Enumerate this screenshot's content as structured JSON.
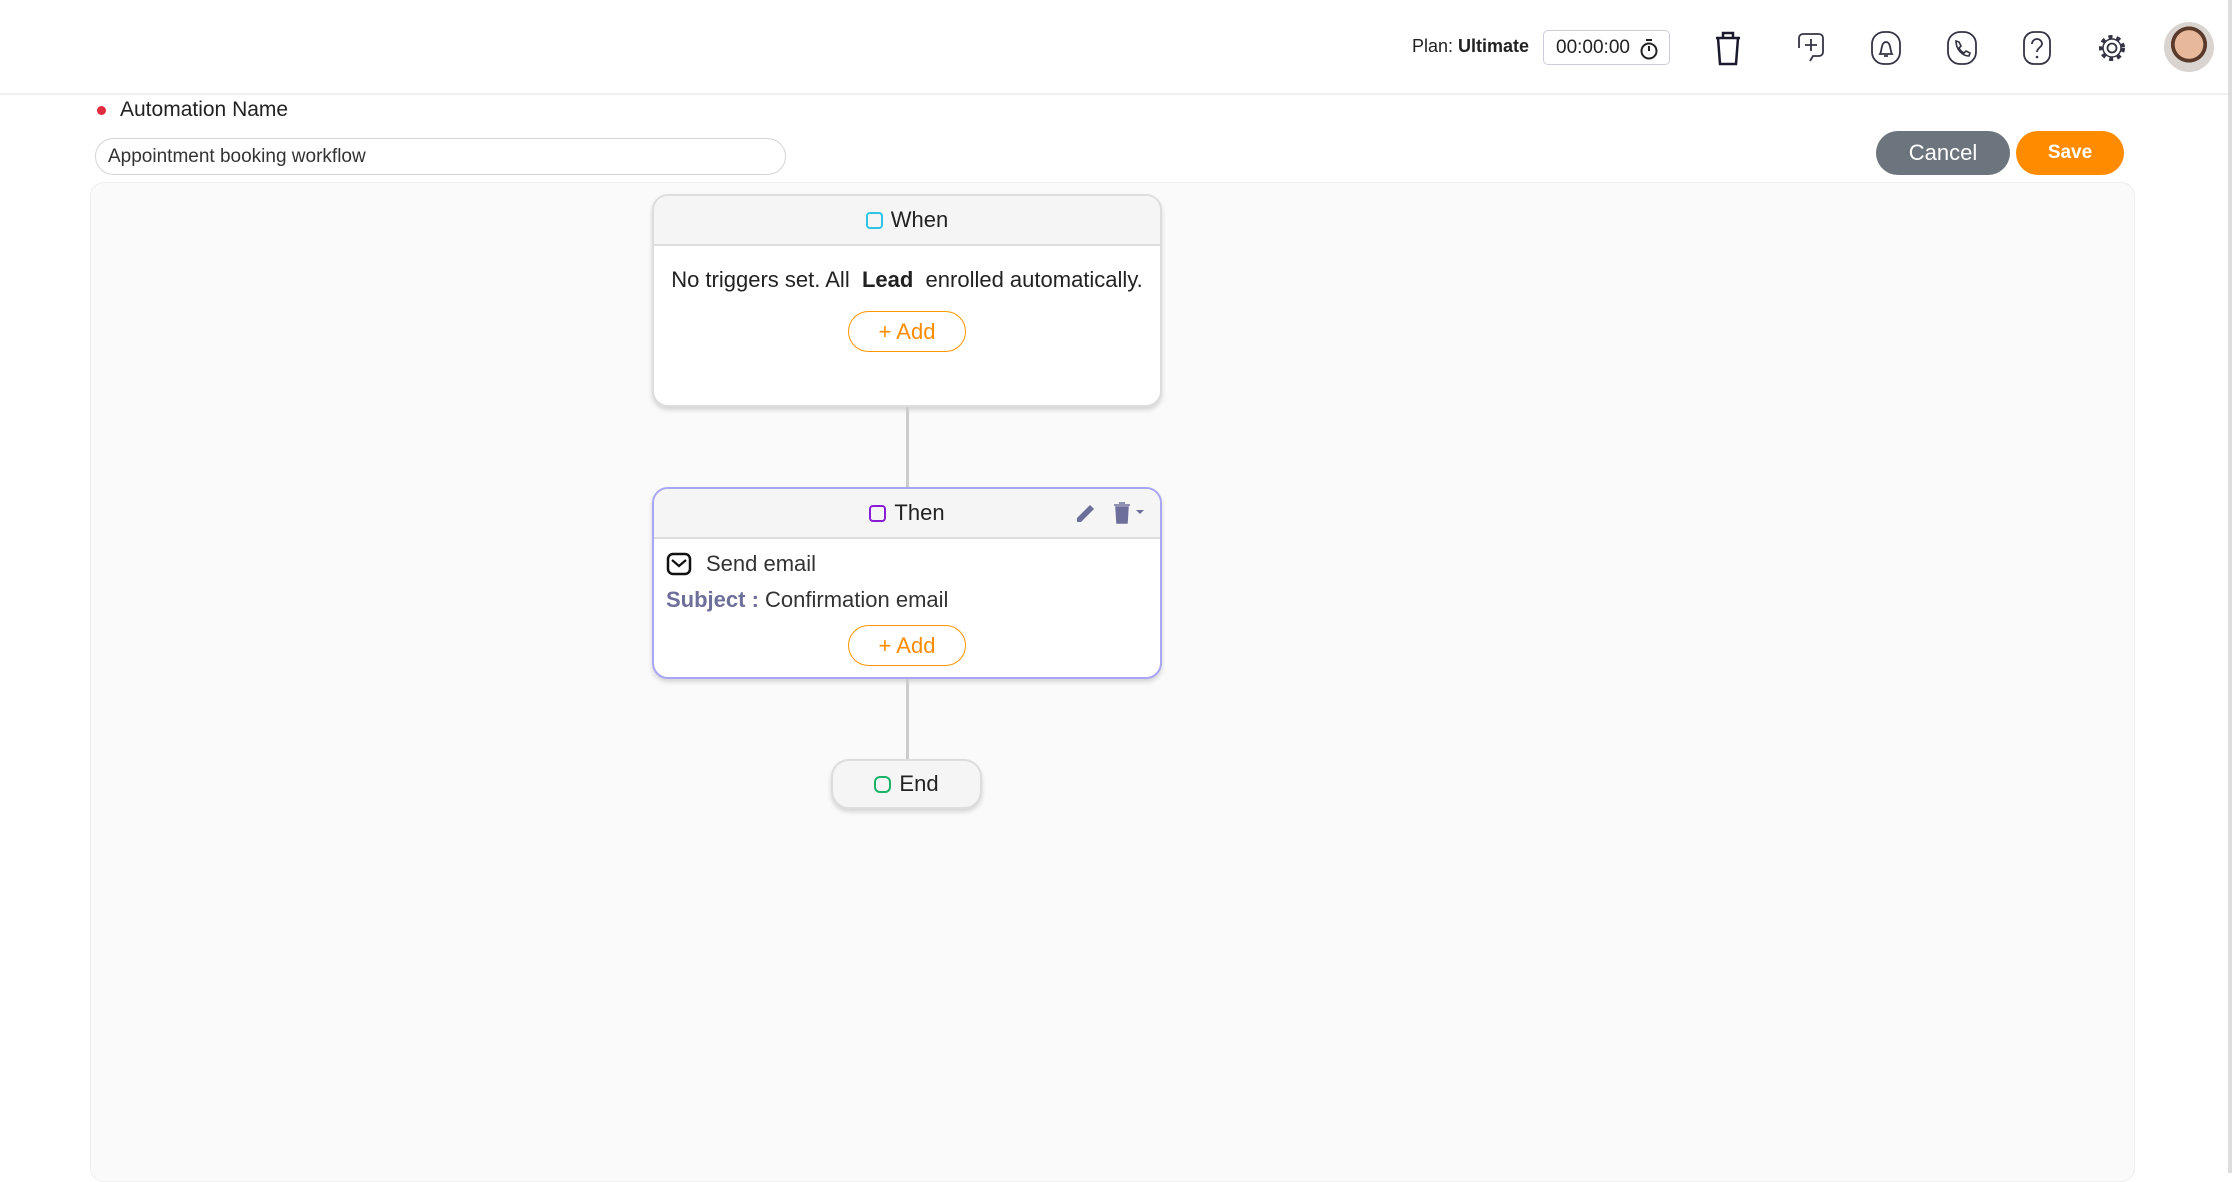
{
  "header": {
    "plan_label": "Plan:",
    "plan_value": "Ultimate",
    "timer": "00:00:00",
    "icons": [
      "trash-icon",
      "add-call-icon",
      "bell-icon",
      "phone-icon",
      "help-icon",
      "gear-icon"
    ]
  },
  "form": {
    "label": "Automation Name",
    "name_value": "Appointment booking workflow",
    "cancel_label": "Cancel",
    "save_label": "Save",
    "required_color": "#e02b3c"
  },
  "flow": {
    "when": {
      "title": "When",
      "text_before": "No triggers set. All",
      "entity": "Lead",
      "text_after": "enrolled automatically.",
      "add_label": "Add",
      "color": "#2ec4e6"
    },
    "then": {
      "title": "Then",
      "action": "Send email",
      "subject_label": "Subject :",
      "subject_value": "Confirmation email",
      "add_label": "Add",
      "color": "#8a1cd6"
    },
    "end": {
      "title": "End",
      "color": "#1bb36a"
    }
  },
  "colors": {
    "accent": "#ff8c00",
    "cancel": "#6c757d"
  }
}
